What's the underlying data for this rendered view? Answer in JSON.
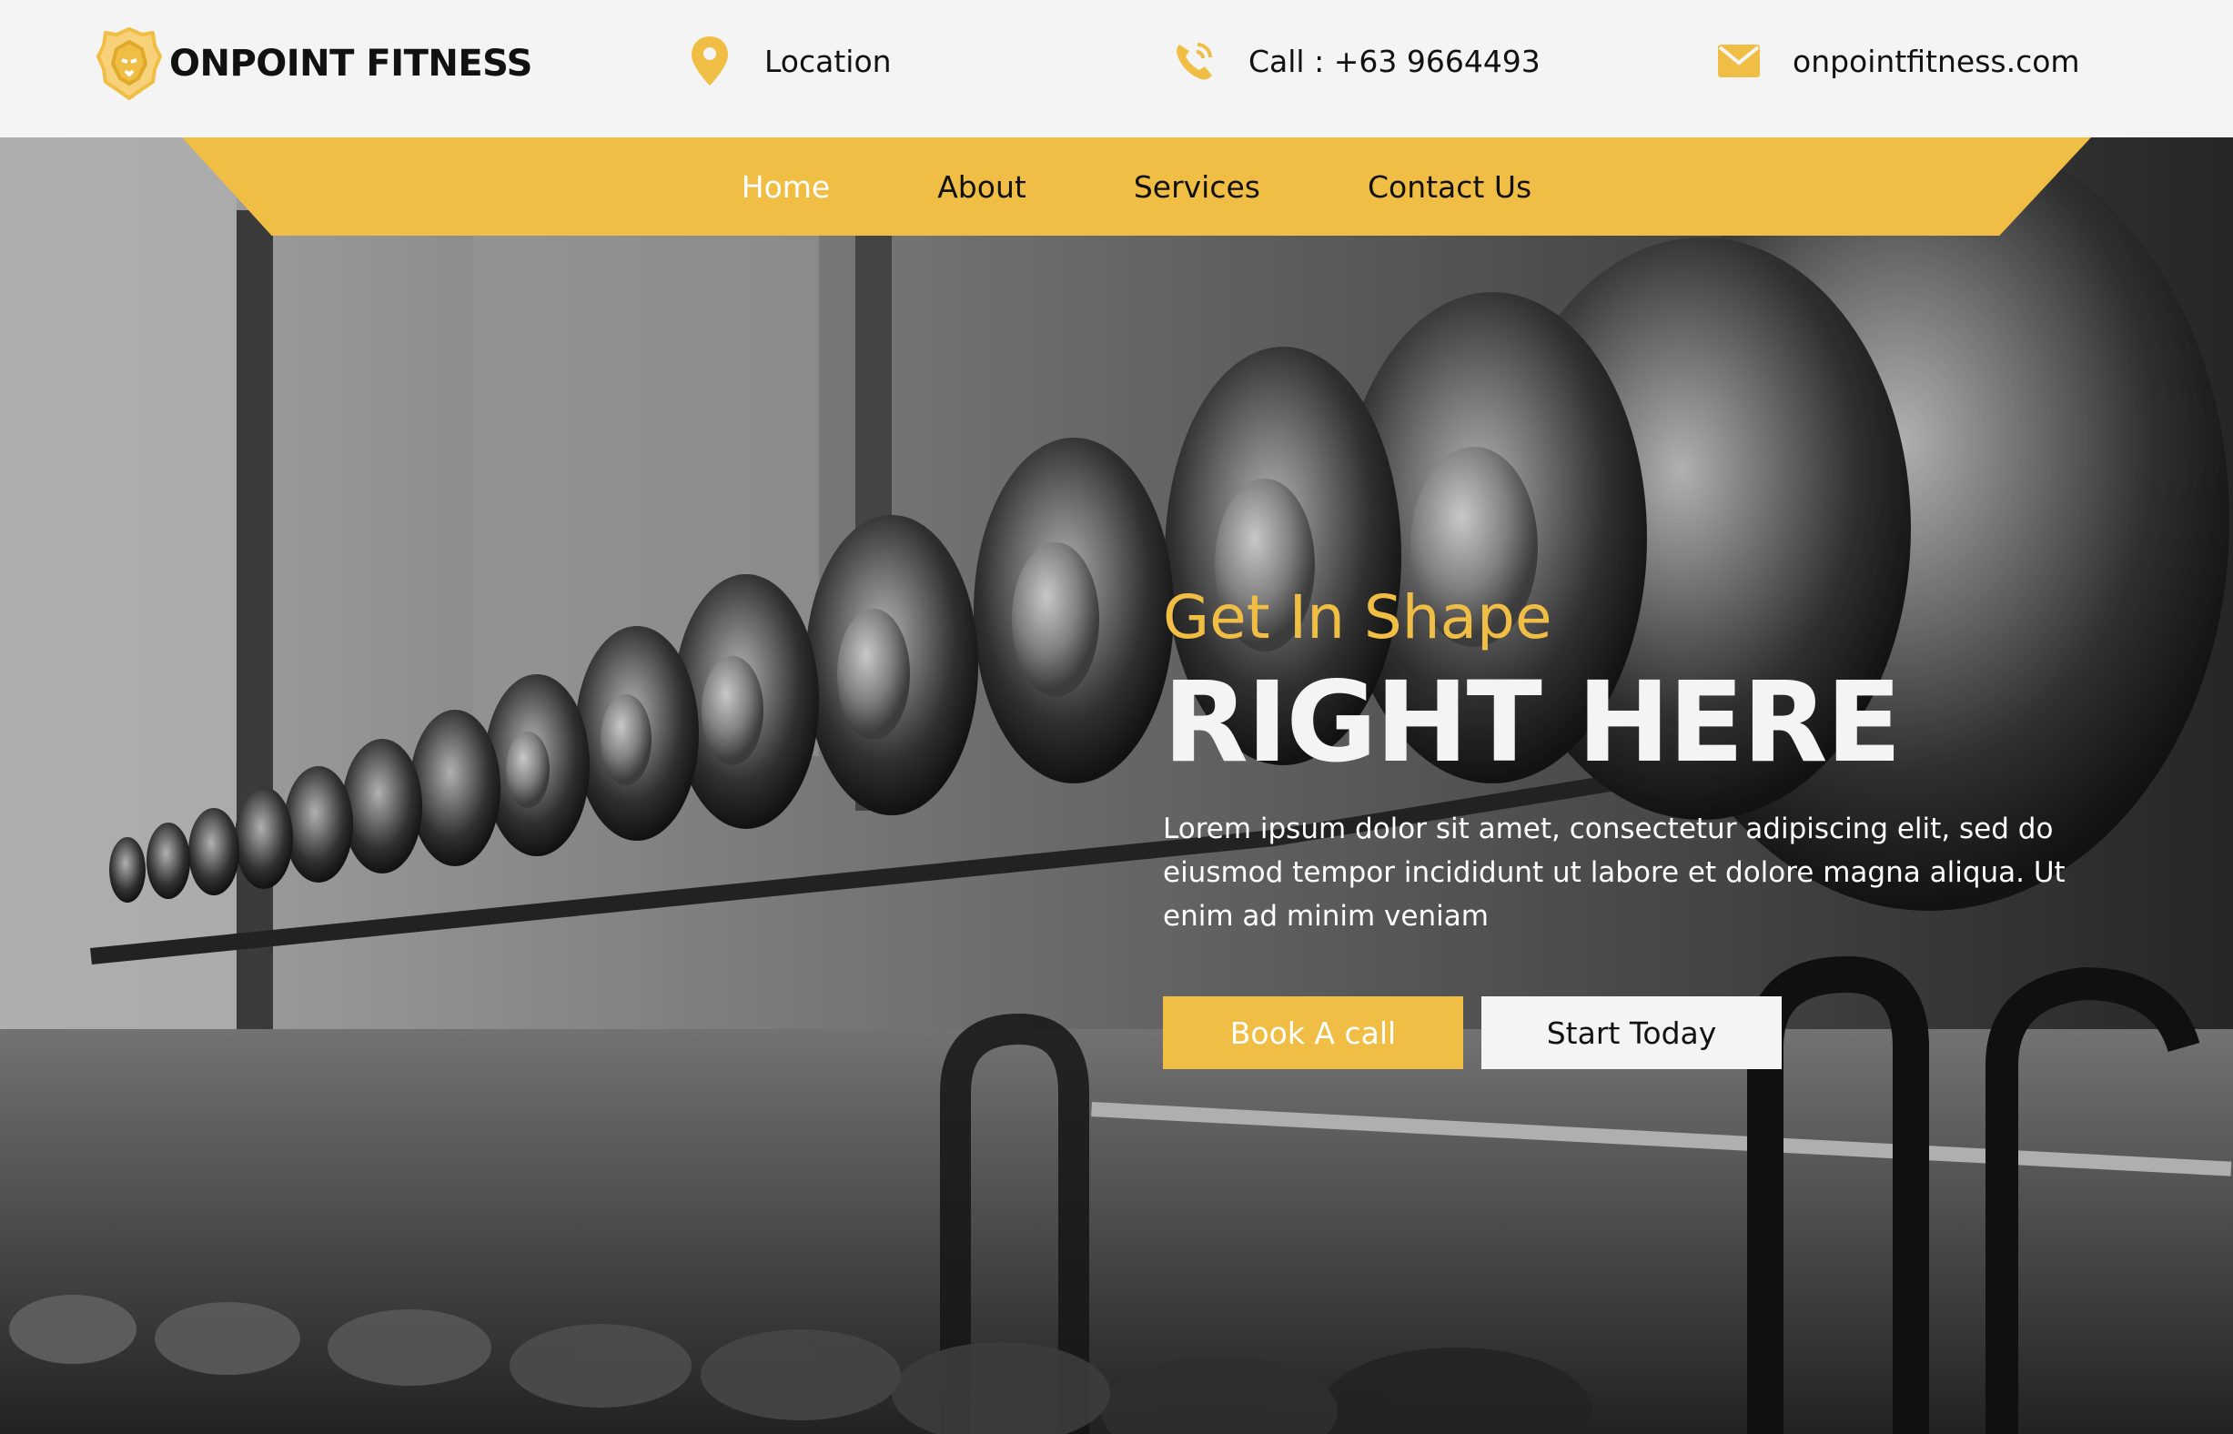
{
  "brand": {
    "name": "ONPOINT FITNESS"
  },
  "contact": {
    "location_label": "Location",
    "phone_label": "Call : +63 9664493",
    "email_label": "onpointfitness.com"
  },
  "nav": {
    "items": [
      {
        "label": "Home",
        "active": true
      },
      {
        "label": "About",
        "active": false
      },
      {
        "label": "Services",
        "active": false
      },
      {
        "label": "Contact Us",
        "active": false
      }
    ]
  },
  "hero": {
    "kicker": "Get In Shape",
    "headline": "RIGHT HERE",
    "description": "Lorem ipsum dolor sit amet, consectetur adipiscing elit, sed do eiusmod tempor incididunt ut labore et dolore magna aliqua. Ut enim ad minim veniam",
    "primary_cta": "Book A call",
    "secondary_cta": "Start Today"
  },
  "icons": {
    "logo": "lion-head-icon",
    "location": "map-pin-icon",
    "phone": "phone-icon",
    "email": "envelope-icon"
  },
  "colors": {
    "accent": "#f0be45",
    "topbar_bg": "#f4f4f4",
    "text_dark": "#111111",
    "text_light": "#ffffff"
  }
}
